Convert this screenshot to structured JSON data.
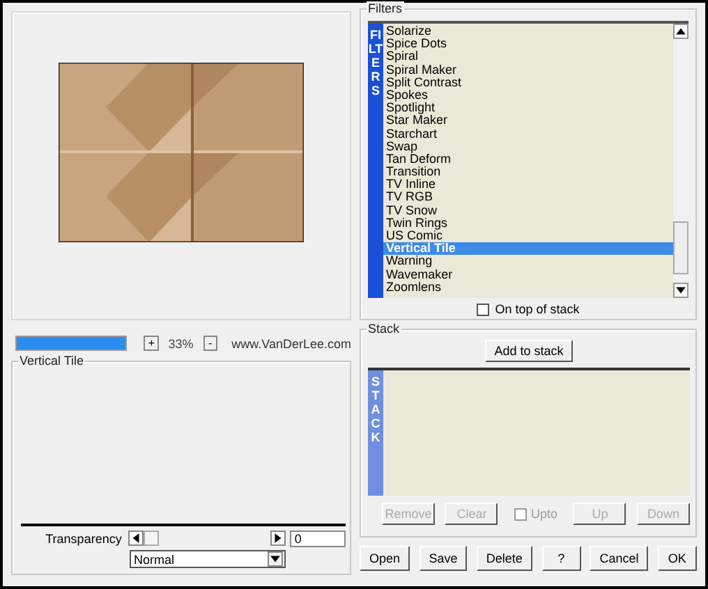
{
  "zoom": {
    "level": 1,
    "zoom_in": "+",
    "value": "33%",
    "zoom_out": "-"
  },
  "website": "www.VanDerLee.com",
  "settings_group": {
    "title": "Vertical Tile"
  },
  "transparency": {
    "label": "Transparency",
    "value": "0"
  },
  "blend_mode": "Normal",
  "filters": {
    "title": "Filters",
    "side_label": "FILTERS",
    "items": [
      {
        "label": "Solarize",
        "selected": false
      },
      {
        "label": "Spice Dots",
        "selected": false
      },
      {
        "label": "Spiral",
        "selected": false
      },
      {
        "label": "Spiral Maker",
        "selected": false
      },
      {
        "label": "Split Contrast",
        "selected": false
      },
      {
        "label": "Spokes",
        "selected": false
      },
      {
        "label": "Spotlight",
        "selected": false
      },
      {
        "label": "Star Maker",
        "selected": false
      },
      {
        "label": "Starchart",
        "selected": false
      },
      {
        "label": "Swap",
        "selected": false
      },
      {
        "label": "Tan Deform",
        "selected": false
      },
      {
        "label": "Transition",
        "selected": false
      },
      {
        "label": "TV Inline",
        "selected": false
      },
      {
        "label": "TV RGB",
        "selected": false
      },
      {
        "label": "TV Snow",
        "selected": false
      },
      {
        "label": "Twin Rings",
        "selected": false
      },
      {
        "label": "US Comic",
        "selected": false
      },
      {
        "label": "Vertical Tile",
        "selected": true
      },
      {
        "label": "Warning",
        "selected": false
      },
      {
        "label": "Wavemaker",
        "selected": false
      },
      {
        "label": "Zoomlens",
        "selected": false
      }
    ],
    "on_top_of_stack": {
      "label": "On top of stack",
      "checked": false
    }
  },
  "stack": {
    "title": "Stack",
    "add_button": "Add to stack",
    "side_label": "STACK",
    "buttons": [
      {
        "label": "Remove",
        "disabled": true
      },
      {
        "label": "Clear",
        "disabled": true
      },
      {
        "label": "Up",
        "disabled": true
      },
      {
        "label": "Down",
        "disabled": true
      }
    ],
    "upto": {
      "label": "Upto",
      "checked": false,
      "disabled": true
    }
  },
  "buttons": [
    "Open",
    "Save",
    "Delete",
    "?",
    "Cancel",
    "OK"
  ]
}
